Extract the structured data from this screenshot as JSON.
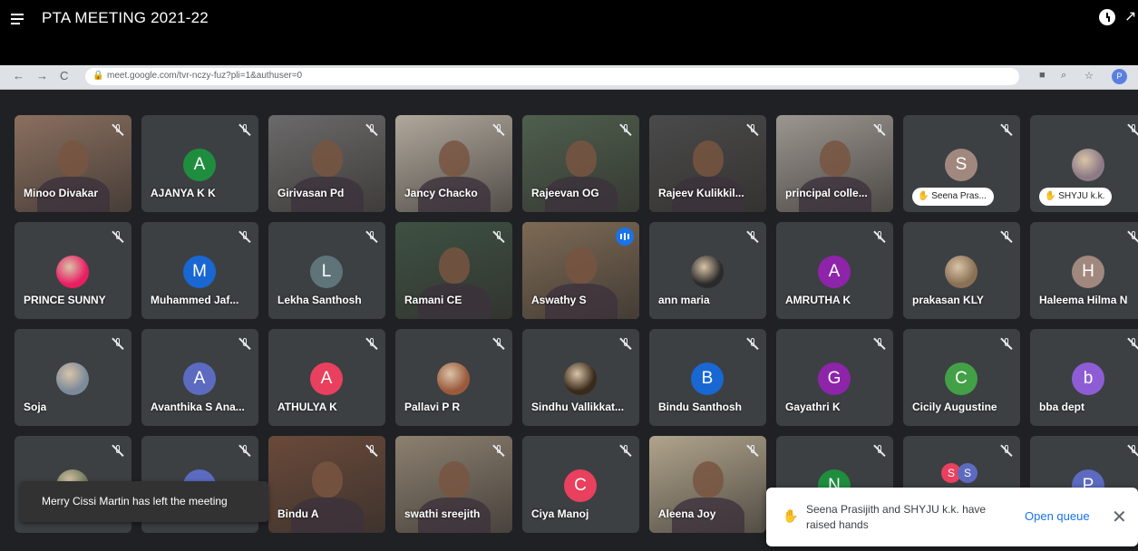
{
  "window": {
    "title": "PTA MEETING 2021-22"
  },
  "browser": {
    "url": "meet.google.com/tvr-nczy-fuz?pli=1&authuser=0",
    "profile_initial": "P",
    "back": "←",
    "forward": "→",
    "reload": "C"
  },
  "participants": [
    {
      "name": "Minoo Divakar",
      "type": "video",
      "bg": "#8a6f5f"
    },
    {
      "name": "AJANYA K K",
      "type": "avatar",
      "initial": "A",
      "color": "#1e8e3e"
    },
    {
      "name": "Girivasan Pd",
      "type": "video",
      "bg": "#6b6a6a"
    },
    {
      "name": "Jancy Chacko",
      "type": "video",
      "bg": "#b0a89c"
    },
    {
      "name": "Rajeevan OG",
      "type": "video",
      "bg": "#4e5f4d"
    },
    {
      "name": "Rajeev Kulikkil...",
      "type": "video",
      "bg": "#4a4a4a"
    },
    {
      "name": "principal colle...",
      "type": "video",
      "bg": "#9c9690"
    },
    {
      "name": "Seena Pras...",
      "type": "avatar-hand",
      "initial": "S",
      "color": "#a1887f"
    },
    {
      "name": "SHYJU k.k.",
      "type": "photo-hand",
      "color": "#8c7a86"
    },
    {
      "name": "PRINCE SUNNY",
      "type": "photo",
      "color": "#e91e63"
    },
    {
      "name": "Muhammed Jaf...",
      "type": "avatar",
      "initial": "M",
      "color": "#1967d2"
    },
    {
      "name": "Lekha Santhosh",
      "type": "avatar",
      "initial": "L",
      "color": "#5f7479"
    },
    {
      "name": "Ramani CE",
      "type": "video",
      "bg": "#3e5143"
    },
    {
      "name": "Aswathy S",
      "type": "video-speaking",
      "bg": "#7d6a55"
    },
    {
      "name": "ann maria",
      "type": "photo",
      "color": "#2a2a2a"
    },
    {
      "name": "AMRUTHA K",
      "type": "avatar",
      "initial": "A",
      "color": "#8e24aa"
    },
    {
      "name": "prakasan KLY",
      "type": "photo",
      "color": "#8a7055"
    },
    {
      "name": "Haleema Hilma N",
      "type": "avatar",
      "initial": "H",
      "color": "#a1887f"
    },
    {
      "name": "Soja",
      "type": "photo",
      "color": "#7c8a9a"
    },
    {
      "name": "Avanthika S Ana...",
      "type": "avatar",
      "initial": "A",
      "color": "#5c6bc0"
    },
    {
      "name": "ATHULYA K",
      "type": "avatar",
      "initial": "A",
      "color": "#e8405e"
    },
    {
      "name": "Pallavi P R",
      "type": "photo",
      "color": "#9c5a3c"
    },
    {
      "name": "Sindhu Vallikkat...",
      "type": "photo",
      "color": "#3a2a1a"
    },
    {
      "name": "Bindu Santhosh",
      "type": "avatar",
      "initial": "B",
      "color": "#1967d2"
    },
    {
      "name": "Gayathri K",
      "type": "avatar",
      "initial": "G",
      "color": "#8e24aa"
    },
    {
      "name": "Cicily Augustine",
      "type": "avatar",
      "initial": "C",
      "color": "#43a047"
    },
    {
      "name": "bba dept",
      "type": "avatar",
      "initial": "b",
      "color": "#8e5dd6"
    },
    {
      "name": "",
      "type": "photo",
      "color": "#6c7a5a"
    },
    {
      "name": "",
      "type": "avatar",
      "initial": "",
      "color": "#5c6bc0"
    },
    {
      "name": "Bindu A",
      "type": "video",
      "bg": "#6a4a3a"
    },
    {
      "name": "swathi sreejith",
      "type": "video",
      "bg": "#8c8070"
    },
    {
      "name": "Ciya Manoj",
      "type": "avatar",
      "initial": "C",
      "color": "#e8405e"
    },
    {
      "name": "Aleena Joy",
      "type": "video",
      "bg": "#b0a48c"
    },
    {
      "name": "",
      "type": "avatar",
      "initial": "N",
      "color": "#1e8e3e"
    },
    {
      "name": "",
      "type": "avatar-pair",
      "initial": "S",
      "color": "#e8405e"
    },
    {
      "name": "",
      "type": "avatar",
      "initial": "P",
      "color": "#5c6bc0"
    }
  ],
  "toast_left": {
    "text": "Merry Cissi Martin has left the meeting"
  },
  "toast_right": {
    "text": "Seena Prasijith and SHYJU k.k. have raised hands",
    "action": "Open queue",
    "close": "✕"
  }
}
